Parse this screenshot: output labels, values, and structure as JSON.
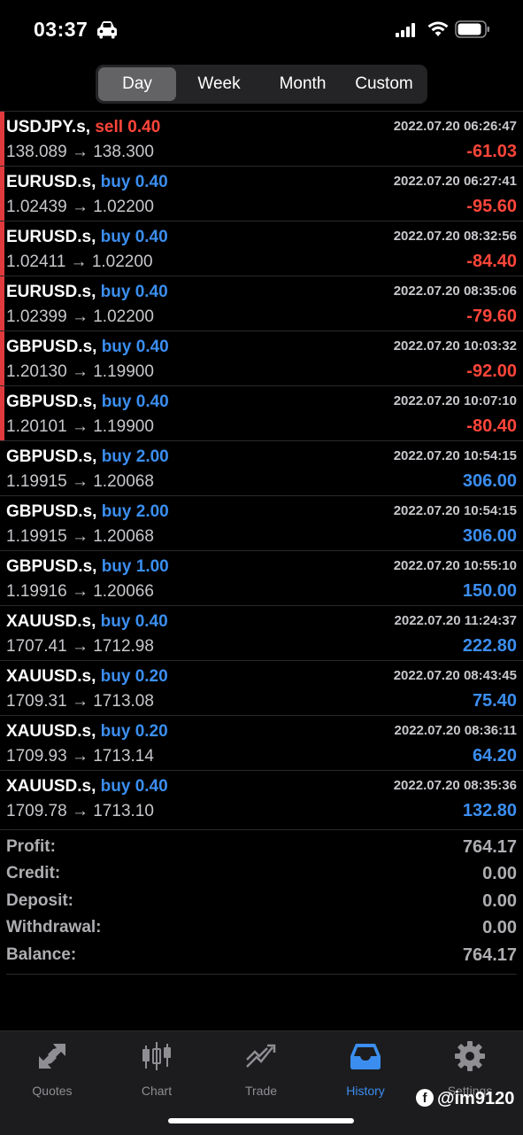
{
  "status_bar": {
    "time": "03:37"
  },
  "segments": [
    "Day",
    "Week",
    "Month",
    "Custom"
  ],
  "active_segment": "Day",
  "trades": [
    {
      "symbol": "USDJPY.s,",
      "side": "sell",
      "volume": "sell 0.40",
      "date": "2022.07.20 06:26:47",
      "prices": "138.089 → 138.300",
      "pnl": "-61.03",
      "loss": true
    },
    {
      "symbol": "EURUSD.s,",
      "side": "buy",
      "volume": "buy 0.40",
      "date": "2022.07.20 06:27:41",
      "prices": "1.02439 → 1.02200",
      "pnl": "-95.60",
      "loss": true
    },
    {
      "symbol": "EURUSD.s,",
      "side": "buy",
      "volume": "buy 0.40",
      "date": "2022.07.20 08:32:56",
      "prices": "1.02411 → 1.02200",
      "pnl": "-84.40",
      "loss": true
    },
    {
      "symbol": "EURUSD.s,",
      "side": "buy",
      "volume": "buy 0.40",
      "date": "2022.07.20 08:35:06",
      "prices": "1.02399 → 1.02200",
      "pnl": "-79.60",
      "loss": true
    },
    {
      "symbol": "GBPUSD.s,",
      "side": "buy",
      "volume": "buy 0.40",
      "date": "2022.07.20 10:03:32",
      "prices": "1.20130 → 1.19900",
      "pnl": "-92.00",
      "loss": true
    },
    {
      "symbol": "GBPUSD.s,",
      "side": "buy",
      "volume": "buy 0.40",
      "date": "2022.07.20 10:07:10",
      "prices": "1.20101 → 1.19900",
      "pnl": "-80.40",
      "loss": true
    },
    {
      "symbol": "GBPUSD.s,",
      "side": "buy",
      "volume": "buy 2.00",
      "date": "2022.07.20 10:54:15",
      "prices": "1.19915 → 1.20068",
      "pnl": "306.00",
      "loss": false
    },
    {
      "symbol": "GBPUSD.s,",
      "side": "buy",
      "volume": "buy 2.00",
      "date": "2022.07.20 10:54:15",
      "prices": "1.19915 → 1.20068",
      "pnl": "306.00",
      "loss": false
    },
    {
      "symbol": "GBPUSD.s,",
      "side": "buy",
      "volume": "buy 1.00",
      "date": "2022.07.20 10:55:10",
      "prices": "1.19916 → 1.20066",
      "pnl": "150.00",
      "loss": false
    },
    {
      "symbol": "XAUUSD.s,",
      "side": "buy",
      "volume": "buy 0.40",
      "date": "2022.07.20 11:24:37",
      "prices": "1707.41 → 1712.98",
      "pnl": "222.80",
      "loss": false
    },
    {
      "symbol": "XAUUSD.s,",
      "side": "buy",
      "volume": "buy 0.20",
      "date": "2022.07.20 08:43:45",
      "prices": "1709.31 → 1713.08",
      "pnl": "75.40",
      "loss": false
    },
    {
      "symbol": "XAUUSD.s,",
      "side": "buy",
      "volume": "buy 0.20",
      "date": "2022.07.20 08:36:11",
      "prices": "1709.93 → 1713.14",
      "pnl": "64.20",
      "loss": false
    },
    {
      "symbol": "XAUUSD.s,",
      "side": "buy",
      "volume": "buy 0.40",
      "date": "2022.07.20 08:35:36",
      "prices": "1709.78 → 1713.10",
      "pnl": "132.80",
      "loss": false
    }
  ],
  "summary": [
    {
      "label": "Profit:",
      "value": "764.17"
    },
    {
      "label": "Credit:",
      "value": "0.00"
    },
    {
      "label": "Deposit:",
      "value": "0.00"
    },
    {
      "label": "Withdrawal:",
      "value": "0.00"
    },
    {
      "label": "Balance:",
      "value": "764.17"
    }
  ],
  "tabs": [
    {
      "label": "Quotes",
      "icon": "quotes-icon"
    },
    {
      "label": "Chart",
      "icon": "chart-icon"
    },
    {
      "label": "Trade",
      "icon": "trade-icon"
    },
    {
      "label": "History",
      "icon": "history-icon"
    },
    {
      "label": "Settings",
      "icon": "settings-icon"
    }
  ],
  "active_tab": "History",
  "watermark": "@im9120",
  "colors": {
    "loss": "#ff453a",
    "buy": "#3b8ef0",
    "accent": "#3b8ef0",
    "loss_bar": "#e0393e"
  }
}
